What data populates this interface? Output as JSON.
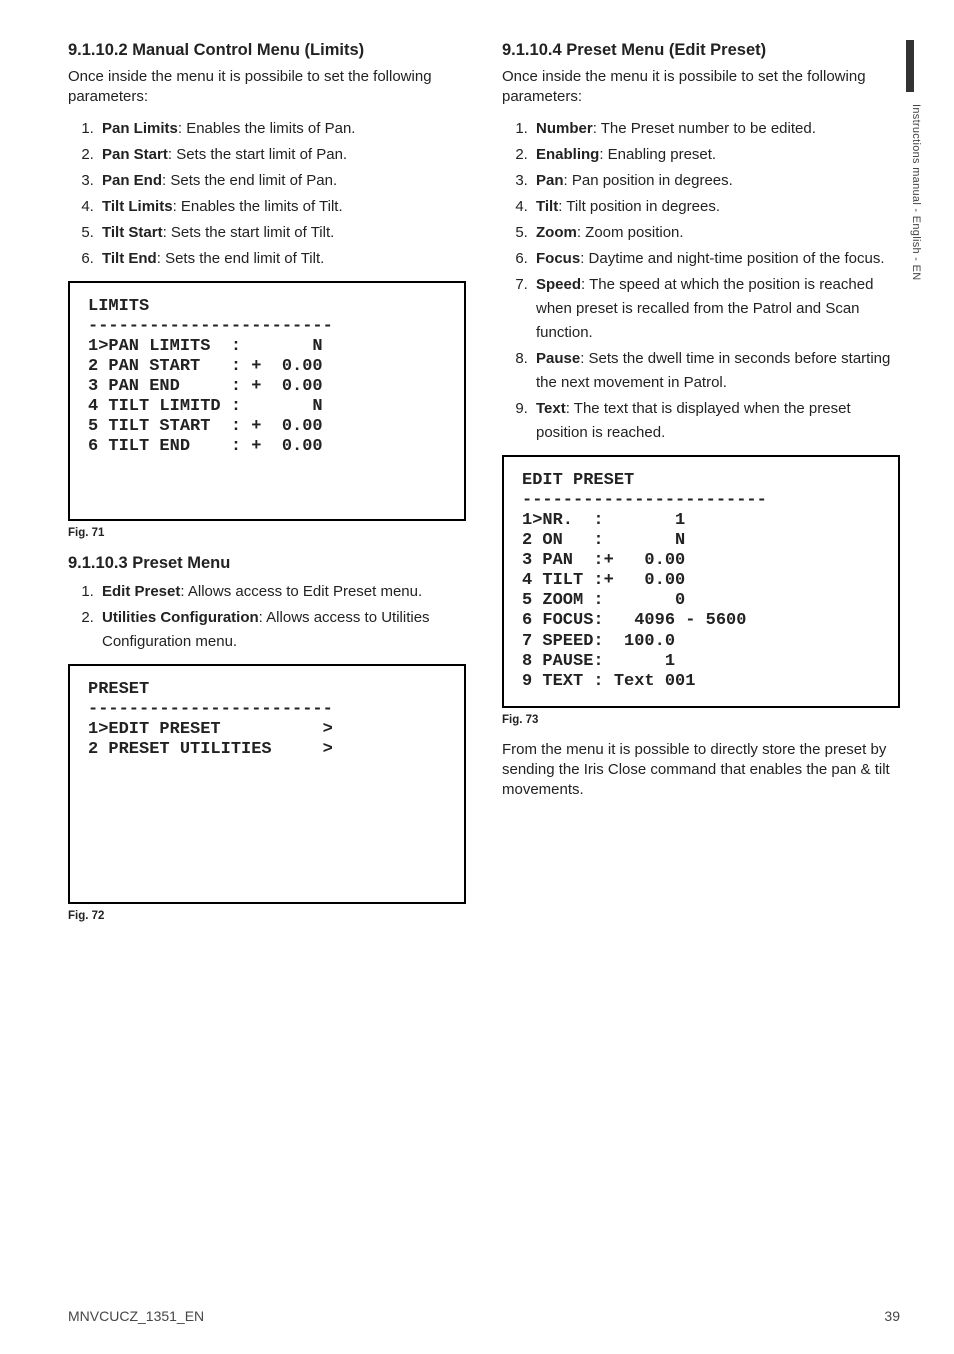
{
  "left": {
    "h1": "9.1.10.2 Manual Control Menu (Limits)",
    "intro": "Once inside the menu it is possibile to set the following parameters:",
    "items": [
      {
        "n": "1.",
        "label": "Pan Limits",
        "desc": ": Enables the limits of Pan."
      },
      {
        "n": "2.",
        "label": "Pan Start",
        "desc": ": Sets the start limit of Pan."
      },
      {
        "n": "3.",
        "label": "Pan End",
        "desc": ": Sets the end limit of Pan."
      },
      {
        "n": "4.",
        "label": "Tilt Limits",
        "desc": ": Enables the limits of Tilt."
      },
      {
        "n": "5.",
        "label": "Tilt Start",
        "desc": ": Sets the start limit of Tilt."
      },
      {
        "n": "6.",
        "label": "Tilt End",
        "desc": ": Sets the end limit of Tilt."
      }
    ],
    "limits_box": "LIMITS\n------------------------\n1>PAN LIMITS  :       N\n2 PAN START   : +  0.00\n3 PAN END     : +  0.00\n4 TILT LIMITD :       N\n5 TILT START  : +  0.00\n6 TILT END    : +  0.00",
    "fig71": "Fig. 71",
    "h2": "9.1.10.3 Preset Menu",
    "items2": [
      {
        "n": "1.",
        "label": "Edit Preset",
        "desc": ": Allows access to Edit Preset menu."
      },
      {
        "n": "2.",
        "label": "Utilities Configuration",
        "desc": ": Allows access to Utilities Configuration menu."
      }
    ],
    "preset_box": "PRESET\n------------------------\n1>EDIT PRESET          >\n2 PRESET UTILITIES     >",
    "fig72": "Fig. 72"
  },
  "right": {
    "h1": "9.1.10.4 Preset Menu (Edit Preset)",
    "intro": "Once inside the menu it is possibile to set the following parameters:",
    "items": [
      {
        "n": "1.",
        "label": "Number",
        "desc": ": The Preset number to be edited."
      },
      {
        "n": "2.",
        "label": "Enabling",
        "desc": ": Enabling preset."
      },
      {
        "n": "3.",
        "label": "Pan",
        "desc": ": Pan position in degrees."
      },
      {
        "n": "4.",
        "label": "Tilt",
        "desc": ": Tilt position in degrees."
      },
      {
        "n": "5.",
        "label": "Zoom",
        "desc": ": Zoom position."
      },
      {
        "n": "6.",
        "label": "Focus",
        "desc": ": Daytime and night-time position of the focus."
      },
      {
        "n": "7.",
        "label": "Speed",
        "desc": ": The speed at which the position is reached when preset is recalled from the Patrol and Scan function."
      },
      {
        "n": "8.",
        "label": "Pause",
        "desc": ": Sets the dwell time in seconds before starting the next movement in Patrol."
      },
      {
        "n": "9.",
        "label": "Text",
        "desc": ": The text that is displayed when the preset position is reached."
      }
    ],
    "editpreset_box": "EDIT PRESET\n------------------------\n1>NR.  :       1\n2 ON   :       N\n3 PAN  :+   0.00\n4 TILT :+   0.00\n5 ZOOM :       0\n6 FOCUS:   4096 - 5600\n7 SPEED:  100.0\n8 PAUSE:      1\n9 TEXT : Text 001",
    "fig73": "Fig. 73",
    "after": "From the menu it is possible to directly store the preset by sending the Iris Close command that enables the pan & tilt movements."
  },
  "sidetab": "Instructions manual - English - EN",
  "footer_left": "MNVCUCZ_1351_EN",
  "footer_right": "39"
}
